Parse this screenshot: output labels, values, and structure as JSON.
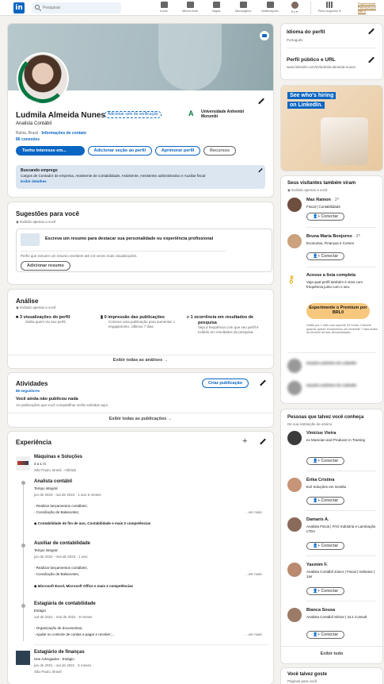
{
  "nav": {
    "logo": "in",
    "search_placeholder": "Pesquisar",
    "items": [
      {
        "label": "Início"
      },
      {
        "label": "Minha rede"
      },
      {
        "label": "Vagas"
      },
      {
        "label": "Mensagens"
      },
      {
        "label": "Notificações"
      },
      {
        "label": "Eu ▾"
      },
      {
        "label": "Para negócios ▾"
      }
    ],
    "premium": "Experimente Premium por BRL0"
  },
  "profile": {
    "photo_badge": "#OPENTOWORK",
    "name": "Ludmila Almeida Nunes",
    "verify": "Adicionar selo de verificação",
    "headline": "Analista Contábil",
    "location": "Bahia, Brasil",
    "contact": "Informações de contato",
    "connections": "86 conexões",
    "school": "Universidade Anhembi Morumbi",
    "btn_open": "Tenho interesse em...",
    "btn_add": "Adicionar seção ao perfil",
    "btn_improve": "Aprimorar perfil",
    "btn_resources": "Recursos",
    "job_title": "Buscando emprego",
    "job_desc": "Cargos de Contador de empresa, Assistente de contabilidade, Assistente, Assistente administrativo e Auxiliar fiscal",
    "job_link": "Exibir detalhes"
  },
  "suggestions": {
    "title": "Sugestões para você",
    "private": "Exibido apenas a você",
    "box_text": "Escreva um resumo para destacar sua personalidade ou experiência profissional",
    "box_note": "Perfis que incluem um resumo recebem até 3,9 vezes mais visualizações.",
    "box_button": "Adicionar resumo"
  },
  "analysis": {
    "title": "Análise",
    "private": "Exibido apenas a você",
    "stats": [
      {
        "title": "3 visualizações do perfil",
        "desc": "Saiba quem viu seu perfil."
      },
      {
        "title": "0 impressão das publicações",
        "desc": "Comece uma publicação para aumentar o engajamento. Últimos 7 dias"
      },
      {
        "title": "1 ocorrência em resultados de pesquisa",
        "desc": "Veja a frequência com que seu perfil é exibido em resultados de pesquisa."
      }
    ],
    "footer": "Exibir todas as análises →"
  },
  "activity": {
    "title": "Atividades",
    "followers": "86 seguidores",
    "button": "Criar publicação",
    "empty": "Você ainda não publicou nada",
    "empty_desc": "As publicações que você compartilhar serão exibidas aqui.",
    "footer": "Exibir todas as publicações →"
  },
  "experience": {
    "title": "Experiência",
    "company1": {
      "name": "Máquinas e Soluções",
      "duration": "3 a 1 m",
      "location": "São Paulo, Brasil · Híbrida",
      "roles": [
        {
          "title": "Analista contábil",
          "type": "Tempo integral",
          "dates": "jun de 2023 - out de 2024 · 1 ano 5 meses",
          "bullets": [
            "- Realizar lançamentos contábeis;",
            "- Conciliação de Balancetes;"
          ],
          "more": "...ver mais",
          "skills": "Contabilidade de fim de ano, Contabilidade e mais 2 competências"
        },
        {
          "title": "Auxiliar de contabilidade",
          "type": "Tempo integral",
          "dates": "jun de 2022 - mai de 2023 · 1 ano",
          "bullets": [
            "- Realizar lançamentos contábeis;",
            "- Conciliação de Balancetes;"
          ],
          "more": "...ver mais",
          "skills": "Microsoft Excel, Microsoft Office e mais 2 competências"
        },
        {
          "title": "Estagiária de contabilidade",
          "type": "Estágio",
          "dates": "out de 2021 - mai de 2022 · 8 meses",
          "bullets": [
            "- Organização de documentos;",
            "- Ajudar no controle de contas a pagar e receber;..."
          ],
          "more": "...ver mais",
          "skills": ""
        }
      ]
    },
    "company2": {
      "title": "Estagiário de finanças",
      "company": "Hee Advogados · Estágio",
      "dates": "jun de 2021 - out de 2021 · 5 meses",
      "location": "São Paulo, Brasil"
    }
  },
  "side": {
    "lang_title": "Idioma do perfil",
    "lang_value": "Português",
    "public_title": "Perfil público e URL",
    "public_url": "www.linkedin.com/in/ludmila-almeida-nunes",
    "ad_line1": "See who's hiring",
    "ad_line2": "on LinkedIn.",
    "visitors_title": "Seus visitantes também viram",
    "visitors_private": "Exibido apenas a você",
    "visitors": [
      {
        "name": "Max Ramon",
        "degree": "· 2º",
        "title": "Fiscal | Contabilidade",
        "button": "Conectar"
      },
      {
        "name": "Bruna Maria Bonjorno",
        "degree": "· 2º",
        "title": "Economia, Finanças e Comex",
        "button": "Conectar"
      }
    ],
    "premium_title": "Acesse a lista completa",
    "premium_desc": "Veja qual perfil também é visto com frequência junto com o seu.",
    "premium_button": "Experimente o Premium por BRL0",
    "premium_note": "Grátis por 1 mês com suporte 24 horas. Cancele quando quiser. Enviaremos um lembrete 7 dias antes do término da sua demonstração.",
    "hidden": [
      "Usuário anônimo do LinkedIn",
      "Usuário anônimo do LinkedIn"
    ],
    "pymk_title": "Pessoas que talvez você conheça",
    "pymk_subtitle": "De sua instituição de ensino",
    "pymk": [
      {
        "name": "Vinicius Vieira",
        "title": "ex Musician and Producer in Training",
        "button": "Conectar"
      },
      {
        "name": "Érika Cristina",
        "title": "Ecil Soluções em Gestão",
        "button": "Conectar"
      },
      {
        "name": "Damaris A.",
        "title": "Analista Fiscal | FAG Indústria e Laminação LTDA",
        "button": "Conectar"
      },
      {
        "name": "Yasmim F.",
        "title": "Analista Contábil Júnior | Fiscal | Indiretos | 1as",
        "button": "Conectar"
      },
      {
        "name": "Bianca Sousa",
        "title": "Analista Contábil Sênior | SL1 Consult",
        "button": "Conectar"
      }
    ],
    "pymk_all": "Exibir tudo",
    "like_title": "Você talvez goste",
    "like_subtitle": "Páginas para você"
  },
  "colors": {
    "brand": "#0a66c2",
    "premium": "#f8c77e",
    "open_to_work": "#057642"
  }
}
